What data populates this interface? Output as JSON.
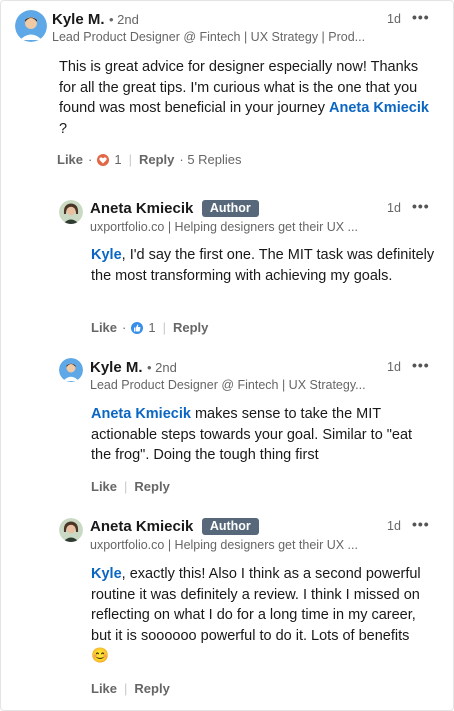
{
  "comments": [
    {
      "author": "Kyle M.",
      "degree": "• 2nd",
      "headline": "Lead Product Designer @ Fintech | UX Strategy | Prod...",
      "time": "1d",
      "more": "•••",
      "text_before": "This is great advice for designer especially now! Thanks for all the great tips. I'm curious what is the one that you found was most beneficial in your journey ",
      "mention": "Aneta Kmiecik",
      "text_after": " ?",
      "like_label": "Like",
      "dot": "·",
      "reaction_count": "1",
      "reply_label": "Reply",
      "replies_label": "· 5 Replies",
      "reaction_icon": "heart-icon",
      "reaction_color": "#e06847"
    },
    {
      "author": "Aneta Kmiecik",
      "badge": "Author",
      "headline": "uxportfolio.co | Helping designers get their UX ...",
      "time": "1d",
      "more": "•••",
      "mention": "Kyle",
      "text_after": ", I'd say the first one. The MIT task was definitely the most transforming with achieving my goals.",
      "like_label": "Like",
      "dot": "·",
      "reaction_count": "1",
      "reply_label": "Reply",
      "reaction_icon": "thumbs-up-icon",
      "reaction_color": "#378fe9"
    },
    {
      "author": "Kyle M.",
      "degree": "• 2nd",
      "headline": "Lead Product Designer @ Fintech | UX Strategy...",
      "time": "1d",
      "more": "•••",
      "mention": "Aneta Kmiecik",
      "text_after": " makes sense to take the MIT actionable steps towards your goal. Similar to \"eat the frog\". Doing the tough thing first",
      "like_label": "Like",
      "reply_label": "Reply"
    },
    {
      "author": "Aneta Kmiecik",
      "badge": "Author",
      "headline": "uxportfolio.co | Helping designers get their UX ...",
      "time": "1d",
      "more": "•••",
      "mention": "Kyle",
      "text_after": ", exactly this! Also I think as a second powerful routine it was definitely a review. I think I missed on reflecting on what I do for a long time in my career, but it is soooooo powerful to do it. Lots of benefits",
      "emoji": "😊",
      "like_label": "Like",
      "reply_label": "Reply"
    }
  ],
  "colors": {
    "link": "#0a66c2",
    "badge_bg": "#56687a",
    "muted": "#666666"
  }
}
